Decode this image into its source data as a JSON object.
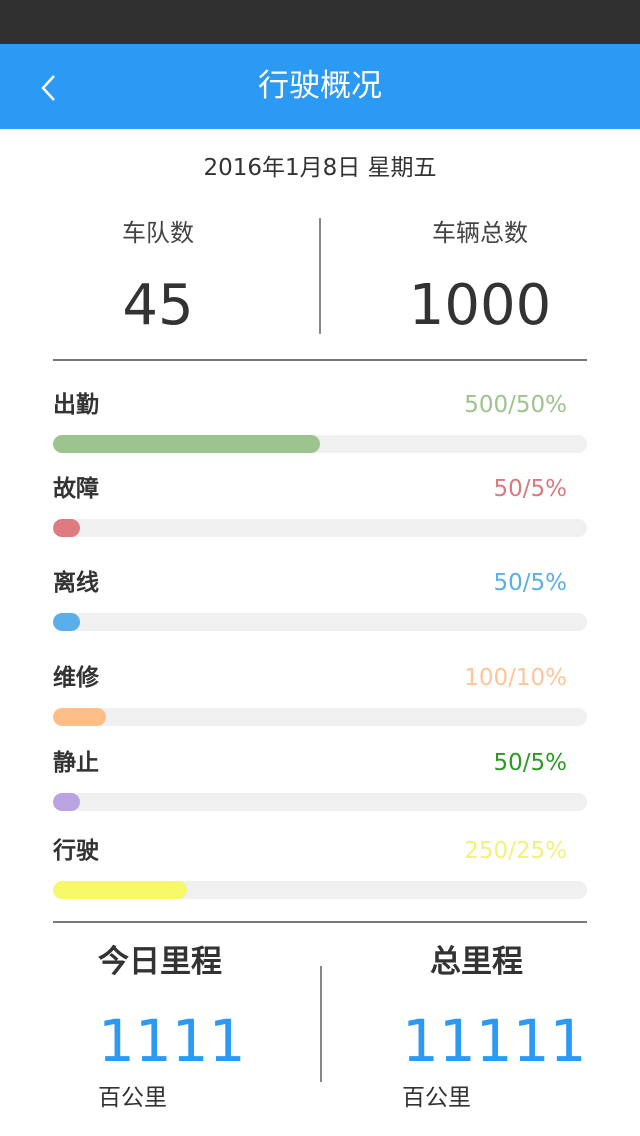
{
  "header": {
    "title": "行驶概况",
    "back_icon": "chevron-left-icon"
  },
  "date": "2016年1月8日  星期五",
  "summary": {
    "fleet_label": "车队数",
    "fleet_value": "45",
    "vehicle_label": "车辆总数",
    "vehicle_value": "1000"
  },
  "statuses": [
    {
      "name": "出勤",
      "value": "500/50%",
      "ratio": 0.5,
      "color": "#9dc48e",
      "text_color": "#9dc48e"
    },
    {
      "name": "故障",
      "value": "50/5%",
      "ratio": 0.05,
      "color": "#de7b80",
      "text_color": "#d97a80"
    },
    {
      "name": "离线",
      "value": "50/5%",
      "ratio": 0.05,
      "color": "#5aaeea",
      "text_color": "#5aaeea"
    },
    {
      "name": "维修",
      "value": "100/10%",
      "ratio": 0.1,
      "color": "#ffbd88",
      "text_color": "#ffc598"
    },
    {
      "name": "静止",
      "value": "50/5%",
      "ratio": 0.05,
      "color": "#b9a3e0",
      "text_color": "#2d9a22"
    },
    {
      "name": "行驶",
      "value": "250/25%",
      "ratio": 0.25,
      "color": "#f7f76a",
      "text_color": "#f4f07a"
    }
  ],
  "mileage": {
    "today_label": "今日里程",
    "today_value": "1111",
    "today_unit": "百公里",
    "total_label": "总里程",
    "total_value": "11111",
    "total_unit": "百公里"
  }
}
